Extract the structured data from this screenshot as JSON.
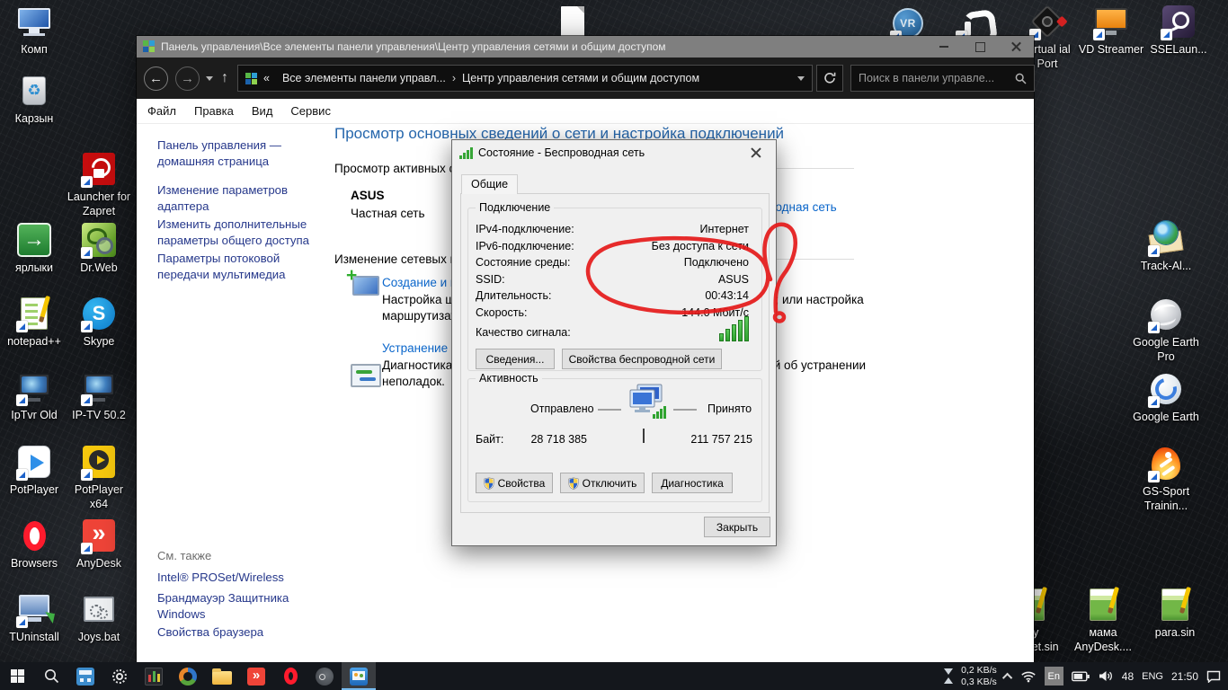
{
  "desktop": {
    "icons": {
      "comp": "Комп",
      "recycle": "Карзын",
      "zapret": "Launcher for Zapret",
      "shortcuts": "ярлыки",
      "drweb": "Dr.Web",
      "npp": "notepad++",
      "skype": "Skype",
      "iptvr_old": "IpTvr Old",
      "iptv502": "IP-TV 50.2",
      "potplayer": "PotPlayer",
      "potplayer64": "PotPlayer x64",
      "browsers": "Browsers",
      "anydesk": "AnyDesk",
      "tuninstall": "TUninstall",
      "joys": "Joys.bat",
      "virtual_port": "Virtual ial Port",
      "vd_streamer": "VD Streamer",
      "sselaun": "SSELaun...",
      "track": "Track-Al...",
      "gearth_pro": "Google Earth Pro",
      "gearth": "Google Earth",
      "gs_sport": "GS-Sport Trainin...",
      "my_internet": "my internet.sin",
      "mama_anydesk": "мама AnyDesk....",
      "para": "para.sin"
    }
  },
  "window": {
    "title": "Панель управления\\Все элементы панели управления\\Центр управления сетями и общим доступом",
    "nav": {
      "crumb_prefix": "«",
      "crumb1": "Все элементы панели управл...",
      "separator": "›",
      "crumb2": "Центр управления сетями и общим доступом",
      "search_placeholder": "Поиск в панели управле..."
    },
    "menu": {
      "file": "Файл",
      "edit": "Правка",
      "view": "Вид",
      "service": "Сервис"
    },
    "sidebar": {
      "home": "Панель управления — домашняя страница",
      "adapter": "Изменение параметров адаптера",
      "sharing": "Изменить дополнительные параметры общего доступа",
      "media": "Параметры потоковой передачи мультимедиа",
      "see_also": "См. также",
      "intel": "Intel® PROSet/Wireless",
      "firewall": "Брандмауэр Защитника Windows",
      "browser_props": "Свойства браузера"
    },
    "content": {
      "heading": "Просмотр основных сведений о сети и настройка подключений",
      "active_networks": "Просмотр активных сетей",
      "network_name": "ASUS",
      "network_type": "Частная сеть",
      "connections_link": "Беспроводная сеть",
      "change_settings": "Изменение сетевых параметров",
      "create_link": "Создание и настройка нового подключения или сети",
      "create_desc1": "Настройка широкополосного, коммутируемого или VPN-подключения; или настройка",
      "create_desc2": "маршрутизатора или точки доступа.",
      "trouble_link": "Устранение неполадок",
      "trouble_desc1": "Диагностика и исправление проблем с сетью или получение сведений об устранении",
      "trouble_desc2": "неполадок."
    }
  },
  "dialog": {
    "title": "Состояние - Беспроводная сеть",
    "tab": "Общие",
    "connection": {
      "label": "Подключение",
      "rows": [
        {
          "label": "IPv4-подключение:",
          "value": "Интернет"
        },
        {
          "label": "IPv6-подключение:",
          "value": "Без доступа к сети"
        },
        {
          "label": "Состояние среды:",
          "value": "Подключено"
        },
        {
          "label": "SSID:",
          "value": "ASUS"
        },
        {
          "label": "Длительность:",
          "value": "00:43:14"
        },
        {
          "label": "Скорость:",
          "value": "144.0 Мбит/с"
        }
      ],
      "signal_label": "Качество сигнала:",
      "details_button": "Сведения...",
      "wireless_props_button": "Свойства беспроводной сети"
    },
    "activity": {
      "label": "Активность",
      "sent_label": "Отправлено",
      "received_label": "Принято",
      "bytes_label": "Байт:",
      "sent_value": "28 718 385",
      "received_value": "211 757 215",
      "properties_button": "Свойства",
      "disconnect_button": "Отключить",
      "diagnostics_button": "Диагностика"
    },
    "close_button": "Закрыть"
  },
  "taskbar": {
    "apps": [
      "start",
      "search",
      "calculator",
      "settings",
      "monitor-bars",
      "color-ring",
      "file-explorer",
      "anydesk",
      "opera",
      "round-dark",
      "control-panel"
    ]
  },
  "tray": {
    "down_speed": "0,2 KB/s",
    "up_speed": "0,3 KB/s",
    "lang_short": "En",
    "temp": "48",
    "lang": "ENG",
    "time": "21:50"
  },
  "colors": {
    "accent_blue": "#0a66cb",
    "heading_blue": "#2566ac",
    "sidebar_navy": "#26388b",
    "annotation_red": "#e51a1a",
    "signal_green": "#2fa32f",
    "titlebar_gray": "#7f7f7f"
  }
}
